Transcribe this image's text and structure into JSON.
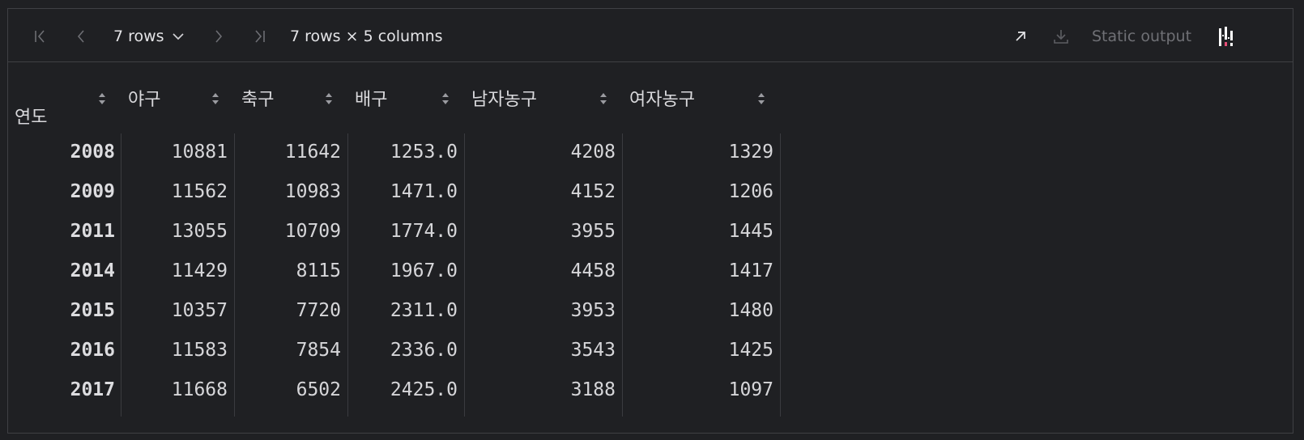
{
  "toolbar": {
    "rows_label": "7 rows",
    "dims_label": "7 rows × 5 columns",
    "static_output_label": "Static output",
    "icons": {
      "first_page": "first-page-icon",
      "prev_page": "chevron-left-icon",
      "rows_dropdown": "chevron-down-icon",
      "next_page": "chevron-right-icon",
      "last_page": "last-page-icon",
      "expand": "expand-arrow-icon",
      "download": "download-icon",
      "plotly_logo": "plotly-logo-icon"
    }
  },
  "table": {
    "index_name": "연도",
    "columns": [
      "야구",
      "축구",
      "배구",
      "남자농구",
      "여자농구"
    ],
    "rows": [
      {
        "index": "2008",
        "values": [
          "10881",
          "11642",
          "1253.0",
          "4208",
          "1329"
        ]
      },
      {
        "index": "2009",
        "values": [
          "11562",
          "10983",
          "1471.0",
          "4152",
          "1206"
        ]
      },
      {
        "index": "2011",
        "values": [
          "13055",
          "10709",
          "1774.0",
          "3955",
          "1445"
        ]
      },
      {
        "index": "2014",
        "values": [
          "11429",
          "8115",
          "1967.0",
          "4458",
          "1417"
        ]
      },
      {
        "index": "2015",
        "values": [
          "10357",
          "7720",
          "2311.0",
          "3953",
          "1480"
        ]
      },
      {
        "index": "2016",
        "values": [
          "11583",
          "7854",
          "2336.0",
          "3543",
          "1425"
        ]
      },
      {
        "index": "2017",
        "values": [
          "11668",
          "6502",
          "2425.0",
          "3188",
          "1097"
        ]
      }
    ]
  }
}
